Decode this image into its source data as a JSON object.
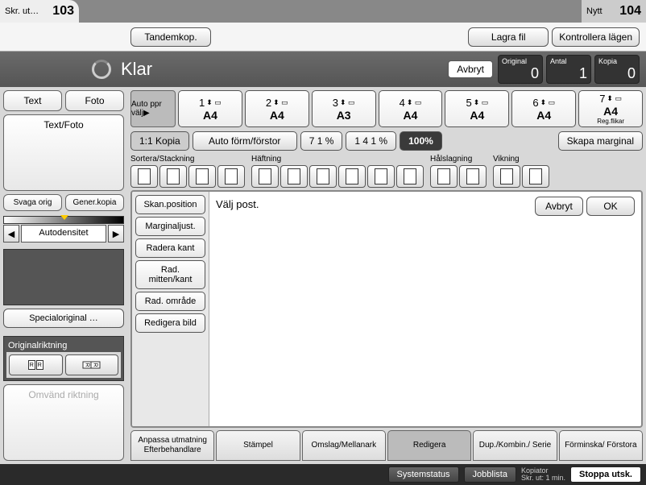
{
  "top_tabs": {
    "left_label": "Skr. ut…",
    "left_num": "103",
    "right_label": "Nytt",
    "right_num": "104"
  },
  "toolbar": {
    "tandem": "Tandemkop.",
    "store": "Lagra fil",
    "check": "Kontrollera lägen"
  },
  "status": {
    "text": "Klar",
    "cancel": "Avbryt",
    "counters": [
      {
        "label": "Original",
        "value": "0"
      },
      {
        "label": "Antal",
        "value": "1"
      },
      {
        "label": "Kopia",
        "value": "0"
      }
    ]
  },
  "modes": {
    "text": "Text",
    "photo": "Foto",
    "textphoto": "Text/Foto",
    "pale": "Svaga orig",
    "gen": "Gener.kopia"
  },
  "density": {
    "label": "Autodensitet"
  },
  "special_orig": "Specialoriginal …",
  "orientation": {
    "title": "Originalriktning",
    "reverse": "Omvänd riktning"
  },
  "paper": {
    "auto": "Auto ppr välj▶",
    "trays": [
      {
        "num": "1",
        "size": "A4",
        "sub": ""
      },
      {
        "num": "2",
        "size": "A4",
        "sub": ""
      },
      {
        "num": "3",
        "size": "A3",
        "sub": ""
      },
      {
        "num": "4",
        "size": "A4",
        "sub": ""
      },
      {
        "num": "5",
        "size": "A4",
        "sub": ""
      },
      {
        "num": "6",
        "size": "A4",
        "sub": ""
      },
      {
        "num": "7",
        "size": "A4",
        "sub": "Reg.flikar"
      }
    ]
  },
  "zoom": {
    "full": "1:1 Kopia",
    "auto": "Auto förm/förstor",
    "down": "7 1 %",
    "up": "1 4 1 %",
    "hundred": "100%",
    "margin": "Skapa marginal"
  },
  "finishing": {
    "sort": "Sortera/Stackning",
    "staple": "Häftning",
    "punch": "Hålslagning",
    "fold": "Vikning"
  },
  "edit": {
    "sidebar": [
      "Skan.position",
      "Marginaljust.",
      "Radera kant",
      "Rad. mitten/kant",
      "Rad. område",
      "Redigera bild"
    ],
    "prompt": "Välj post.",
    "cancel": "Avbryt",
    "ok": "OK"
  },
  "bottom_tabs": [
    "Anpassa utmatning Efterbehandlare",
    "Stämpel",
    "Omslag/Mellanark",
    "Redigera",
    "Dup./Kombin./ Serie",
    "Förminska/ Förstora"
  ],
  "footer": {
    "sys": "Systemstatus",
    "jobs": "Jobblista",
    "mode": "Kopiator",
    "time": "Skr. ut: 1 min.",
    "stop": "Stoppa utsk."
  }
}
